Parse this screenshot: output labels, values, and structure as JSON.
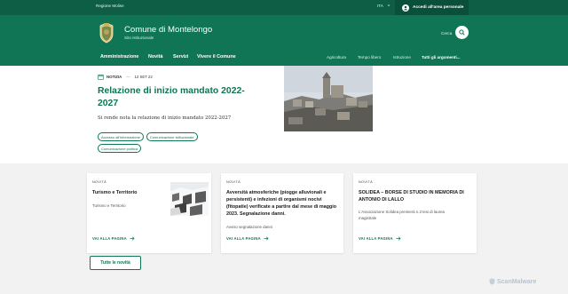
{
  "slim": {
    "region": "Regione Molise",
    "language": "ITA",
    "login": "Accedi all'area personale"
  },
  "header": {
    "municipality": "Comune di Montelongo",
    "subtitle": "Sito istituzionale",
    "search_label": "Cerca"
  },
  "nav": {
    "main": [
      "Amministrazione",
      "Novità",
      "Servizi",
      "Vivere il Comune"
    ],
    "secondary": [
      "Agricoltura",
      "Tempo libero",
      "Istruzione",
      "Tutti gli argomenti..."
    ]
  },
  "hero": {
    "category": "NOTIZIA",
    "date": "12 SET 22",
    "title": "Relazione di inizio mandato 2022-2027",
    "description": "Si rende nota la relazione di inizio mandato 2022-2027",
    "tags": [
      "Accesso all'informazione",
      "Comunicazione istituzionale",
      "Comunicazione politica"
    ]
  },
  "cards": [
    {
      "kicker": "NOVITÀ",
      "title": "Turismo e Territorio",
      "text": "Turismo e Territorio",
      "link": "VAI ALLA PAGINA"
    },
    {
      "kicker": "NOVITÀ",
      "title": "Avversità atmosferiche (piogge alluvionali e persistenti) e infezioni di organismi nocivi (fitopatie) verificate a partire dal mese di maggio 2023. Segnalazione danni.",
      "text": "Avviso segnalazione danni",
      "link": "VAI ALLA PAGINA"
    },
    {
      "kicker": "NOVITÀ",
      "title": "SOLIDEA – BORSE DI STUDIO IN MEMORIA DI ANTONIO DI LALLO",
      "text": "L'Associazione Solidea premierà n.3 tesi di laurea magistrale",
      "link": "VAI ALLA PAGINA"
    }
  ],
  "all_news": "Tutte le novità",
  "watermark": "ScanMalware",
  "colors": {
    "primary": "#0f7554",
    "slim_bar": "#0d5e45",
    "login_bg": "#0a4f3a",
    "page_bg": "#f2f2f2"
  },
  "icons": [
    "chevron-down-icon",
    "user-icon",
    "search-icon",
    "calendar-icon",
    "arrow-right-icon",
    "crest-icon",
    "shield-icon"
  ]
}
